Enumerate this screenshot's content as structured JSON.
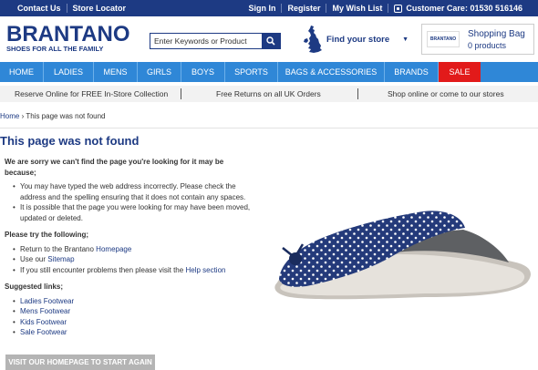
{
  "topbar": {
    "contact": "Contact Us",
    "store_locator": "Store Locator",
    "sign_in": "Sign In",
    "register": "Register",
    "wishlist": "My Wish List",
    "customer_care": "Customer Care: 01530 516146"
  },
  "header": {
    "brand": "BRANTANO",
    "tagline": "SHOES FOR ALL THE FAMILY",
    "search_placeholder": "Enter Keywords or Product",
    "find_store": "Find your store",
    "bag_title": "Shopping Bag",
    "bag_count": "0 products",
    "bag_logo": "BRANTANO"
  },
  "nav": {
    "items": [
      "HOME",
      "LADIES",
      "MENS",
      "GIRLS",
      "BOYS",
      "SPORTS",
      "BAGS & ACCESSORIES",
      "BRANDS",
      "SALE"
    ]
  },
  "promo": {
    "p1": "Reserve Online for FREE In-Store Collection",
    "p2": "Free Returns on all UK Orders",
    "p3": "Shop online or come to our stores"
  },
  "breadcrumb": {
    "home": "Home",
    "sep": "›",
    "current": "This page was not found"
  },
  "page": {
    "title": "This page was not found",
    "intro": "We are sorry we can't find the page you're looking for it may be because;",
    "reasons": [
      "You may have typed the web address incorrectly. Please check the address and the spelling ensuring that it does not contain any spaces.",
      "It is possible that the page you were looking for may have been moved, updated or deleted."
    ],
    "try_heading": "Please try the following;",
    "try_1_prefix": "Return to the Brantano ",
    "try_1_link": "Homepage",
    "try_2_prefix": "Use our ",
    "try_2_link": "Sitemap",
    "try_3_prefix": "If you still encounter problems then please visit the ",
    "try_3_link": "Help section",
    "suggested_heading": "Suggested links;",
    "suggested": [
      "Ladies Footwear",
      "Mens Footwear",
      "Kids Footwear",
      "Sale Footwear"
    ],
    "cta": "VISIT OUR HOMEPAGE TO START AGAIN"
  },
  "colors": {
    "brand_navy": "#1d3a83",
    "nav_blue": "#2f87d7",
    "sale_red": "#e21a1a"
  }
}
